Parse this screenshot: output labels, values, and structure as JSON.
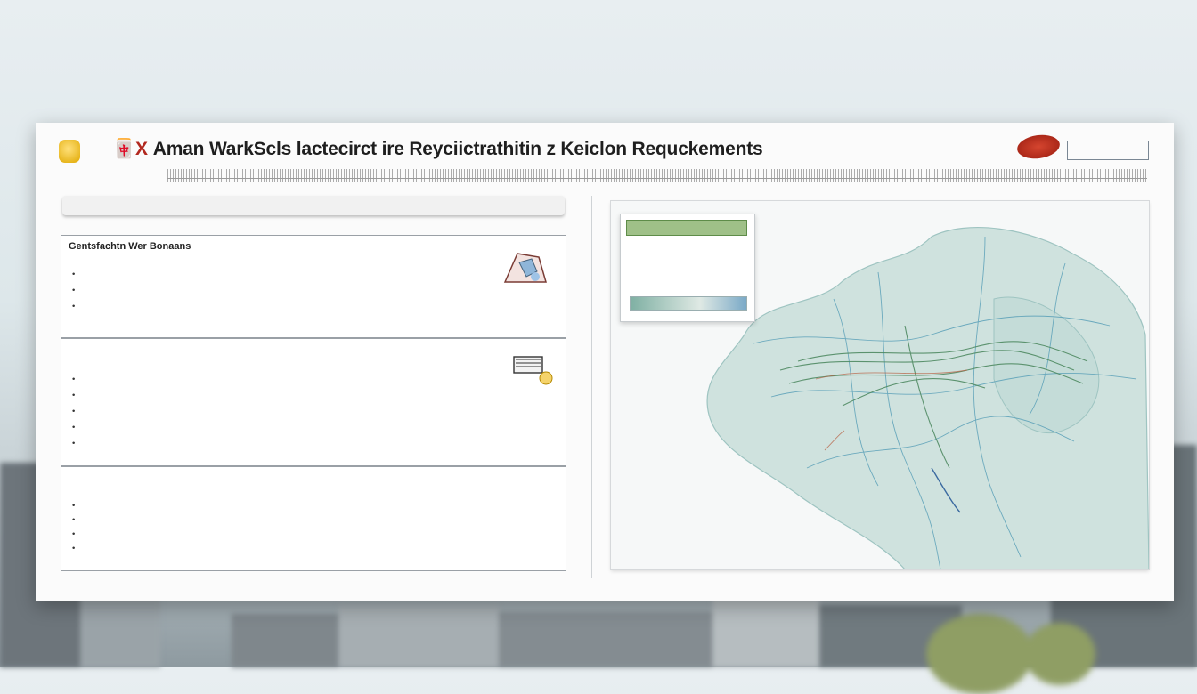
{
  "title": {
    "mark": "🀄X",
    "text": "Aman WarkScls lactecirct ire Reyciictrathitin z Keiclon Requckements"
  },
  "header_badge": "",
  "subheader": "",
  "sections": [
    {
      "title": "Gentsfachtn Wer Bonaans",
      "sub": "",
      "rows": [
        "",
        "",
        ""
      ],
      "notes": [
        ""
      ]
    },
    {
      "title": "",
      "sub": "",
      "rows": [
        "",
        "",
        "",
        "",
        ""
      ],
      "notes": [
        "",
        "",
        ""
      ]
    },
    {
      "title": "",
      "sub": "",
      "rows": [
        "",
        "",
        "",
        ""
      ],
      "notes": [
        "",
        "",
        ""
      ]
    }
  ],
  "footer": "",
  "map": {
    "legend_title": "",
    "legend_lines": [
      "",
      "",
      ""
    ],
    "side_label": ""
  },
  "colors": {
    "accent_red": "#b2281f",
    "map_land": "#cfe2de",
    "map_route": "#4f8a62",
    "map_water": "#5aa0b8"
  }
}
